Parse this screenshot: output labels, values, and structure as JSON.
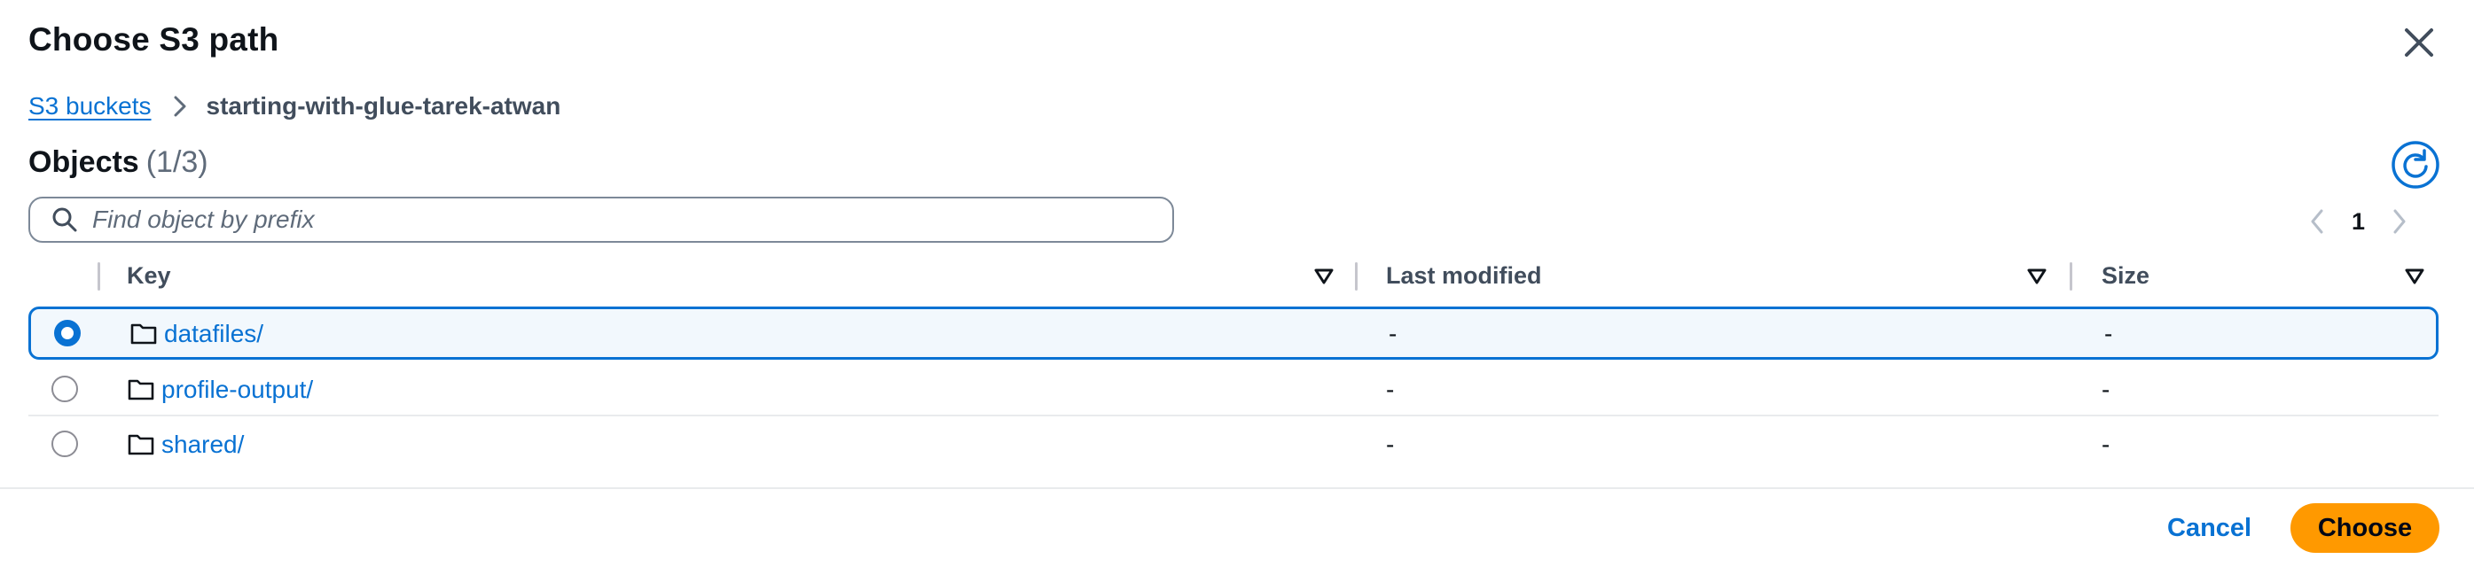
{
  "modal": {
    "title": "Choose S3 path"
  },
  "breadcrumb": {
    "root": "S3 buckets",
    "current": "starting-with-glue-tarek-atwan"
  },
  "objects": {
    "heading": "Objects",
    "count": "(1/3)"
  },
  "search": {
    "placeholder": "Find object by prefix",
    "value": ""
  },
  "pagination": {
    "current_page": "1"
  },
  "table": {
    "columns": [
      "Key",
      "Last modified",
      "Size"
    ],
    "rows": [
      {
        "key": "datafiles/",
        "last_modified": "-",
        "size": "-",
        "selected": true
      },
      {
        "key": "profile-output/",
        "last_modified": "-",
        "size": "-",
        "selected": false
      },
      {
        "key": "shared/",
        "last_modified": "-",
        "size": "-",
        "selected": false
      }
    ]
  },
  "footer": {
    "cancel_label": "Cancel",
    "choose_label": "Choose"
  },
  "colors": {
    "accent": "#0972d3",
    "primary_button": "#ff9900",
    "selected_row_bg": "#f2f8fd"
  },
  "icons": [
    "close-icon",
    "chevron-right-icon",
    "refresh-icon",
    "search-icon",
    "chevron-left-icon",
    "sort-icon",
    "folder-icon"
  ]
}
